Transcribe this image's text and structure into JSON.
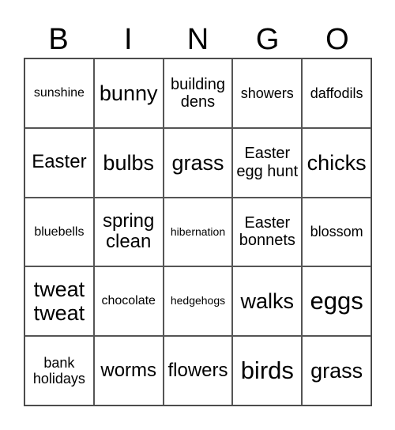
{
  "header": [
    "B",
    "I",
    "N",
    "G",
    "O"
  ],
  "cells": [
    [
      "sunshine",
      "bunny",
      "building dens",
      "showers",
      "daffodils"
    ],
    [
      "Easter",
      "bulbs",
      "grass",
      "Easter egg hunt",
      "chicks"
    ],
    [
      "bluebells",
      "spring clean",
      "hibernation",
      "Easter bonnets",
      "blossom"
    ],
    [
      "tweat tweat",
      "chocolate",
      "hedgehogs",
      "walks",
      "eggs"
    ],
    [
      "bank holidays",
      "worms",
      "flowers",
      "birds",
      "grass"
    ]
  ]
}
